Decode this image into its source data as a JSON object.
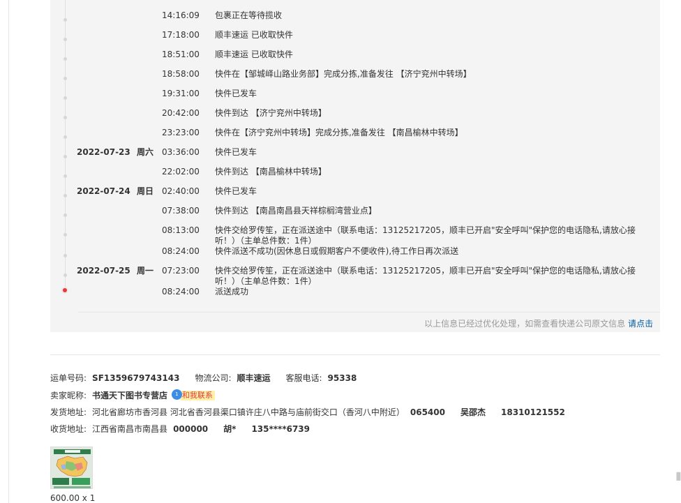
{
  "tracking": {
    "events": [
      {
        "date": "",
        "weekday": "",
        "time": "14:16:09",
        "desc": "包裹正在等待揽收"
      },
      {
        "date": "",
        "weekday": "",
        "time": "17:18:00",
        "desc": "顺丰速运 已收取快件"
      },
      {
        "date": "",
        "weekday": "",
        "time": "18:51:00",
        "desc": "顺丰速运 已收取快件"
      },
      {
        "date": "",
        "weekday": "",
        "time": "18:58:00",
        "desc": "快件在【邹城峄山路业务部】完成分拣,准备发往 【济宁兖州中转场】"
      },
      {
        "date": "",
        "weekday": "",
        "time": "19:31:00",
        "desc": "快件已发车"
      },
      {
        "date": "",
        "weekday": "",
        "time": "20:42:00",
        "desc": "快件到达 【济宁兖州中转场】"
      },
      {
        "date": "",
        "weekday": "",
        "time": "23:23:00",
        "desc": "快件在【济宁兖州中转场】完成分拣,准备发往 【南昌榆林中转场】"
      },
      {
        "date": "2022-07-23",
        "weekday": "周六",
        "time": "03:36:00",
        "desc": "快件已发车"
      },
      {
        "date": "",
        "weekday": "",
        "time": "22:02:00",
        "desc": "快件到达 【南昌榆林中转场】"
      },
      {
        "date": "2022-07-24",
        "weekday": "周日",
        "time": "02:40:00",
        "desc": "快件已发车"
      },
      {
        "date": "",
        "weekday": "",
        "time": "07:38:00",
        "desc": "快件到达 【南昌南昌县天祥棕榈湾营业点】"
      },
      {
        "date": "",
        "weekday": "",
        "time": "08:13:00",
        "desc": "快件交给罗传笙，正在派送途中（联系电话：13125217205，顺丰已开启\"安全呼叫\"保护您的电话隐私,请放心接听！）（主单总件数：1件）"
      },
      {
        "date": "",
        "weekday": "",
        "time": "08:24:00",
        "desc": "快件派送不成功(因休息日或假期客户不便收件),待工作日再次派送"
      },
      {
        "date": "2022-07-25",
        "weekday": "周一",
        "time": "07:23:00",
        "desc": "快件交给罗传笙，正在派送途中（联系电话：13125217205，顺丰已开启\"安全呼叫\"保护您的电话隐私,请放心接听！）（主单总件数：1件）"
      },
      {
        "date": "",
        "weekday": "",
        "time": "08:24:00",
        "desc": "派送成功"
      }
    ],
    "footer_text": "以上信息已经过优化处理，如需查看快递公司原文信息",
    "footer_link": "请点击"
  },
  "shipment": {
    "waybill_label": "运单号码:",
    "waybill_value": "SF1359679743143",
    "carrier_label": "物流公司:",
    "carrier_value": "顺丰速运",
    "service_phone_label": "客服电话:",
    "service_phone_value": "95338",
    "seller_label": "卖家昵称:",
    "seller_value": "书通天下图书专营店",
    "contact_label": "和我联系",
    "contact_badge": "1",
    "ship_from_label": "发货地址:",
    "ship_from_value": "河北省廊坊市香河县 河北省香河县渠口镇许庄八中路与庙前街交口（香河八中附近）",
    "ship_from_zip": "065400",
    "ship_from_name": "吴邵杰",
    "ship_from_phone": "18310121552",
    "ship_to_label": "收货地址:",
    "ship_to_value": "江西省南昌市南昌县",
    "ship_to_zip": "000000",
    "ship_to_name": "胡*",
    "ship_to_phone": "135****6739"
  },
  "product": {
    "price_qty": "600.00 x 1",
    "thumb_icon": "china-map-product-icon"
  },
  "side_widget_icon": "floating-tool-icon",
  "colors": {
    "panel_bg": "#f4f4f4",
    "active_dot": "#e4393c",
    "link": "#005aa0",
    "contact_bg": "#fff0a8",
    "contact_text": "#e4393c",
    "badge": "#3d8ce5"
  }
}
